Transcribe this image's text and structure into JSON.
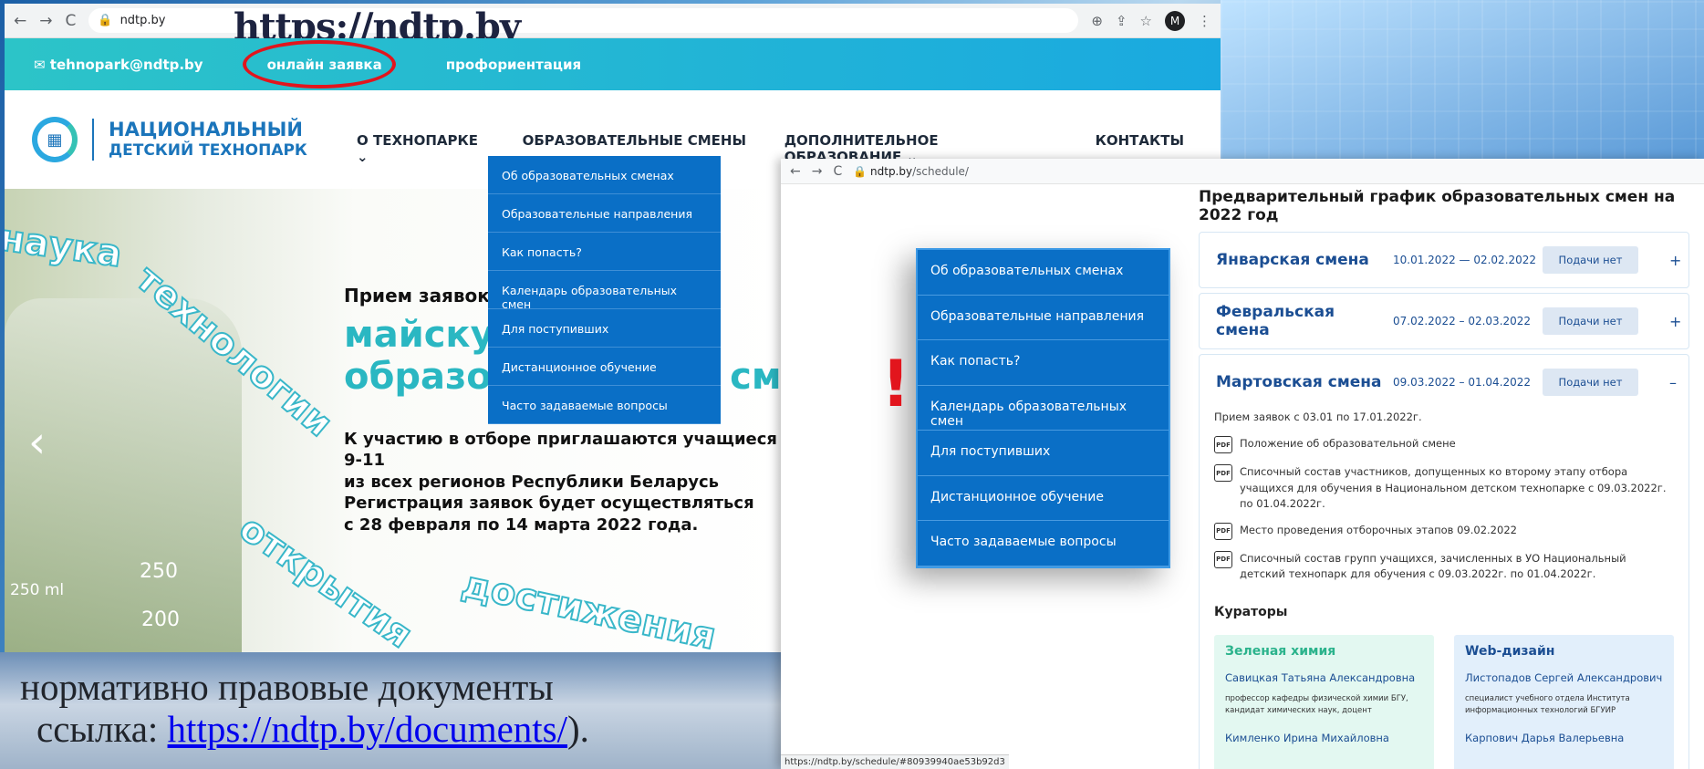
{
  "site": {
    "big_url": "https://ndtp.by",
    "address": "ndtp.by",
    "email": "tehnopark@ndtp.by",
    "topbar_links": [
      "онлайн заявка",
      "профориентация"
    ],
    "logo_line1": "НАЦИОНАЛЬНЫЙ",
    "logo_line2": "ДЕТСКИЙ ТЕХНОПАРК",
    "menu": [
      "О ТЕХНОПАРКЕ",
      "ОБРАЗОВАТЕЛЬНЫЕ СМЕНЫ",
      "ДОПОЛНИТЕЛЬНОЕ ОБРАЗОВАНИЕ",
      "КОНТАКТЫ"
    ],
    "dropdown": [
      "Об образовательных сменах",
      "Образовательные направления",
      "Как попасть?",
      "Календарь образовательных смен",
      "Для поступивших",
      "Дистанционное обучение",
      "Часто задаваемые вопросы"
    ],
    "hero": {
      "title_small": "Прием заявок",
      "title_big1": "майску",
      "title_big2": "образо",
      "title_big2_tail": "о см",
      "body1": "К участию в отборе приглашаются учащиеся 9-11",
      "body2": "из всех регионов Республики Беларусь",
      "body3": "Регистрация заявок будет осуществляться",
      "body4": "с 28 февраля по 14 марта 2022 года.",
      "arc_words": [
        "наука",
        "технологии",
        "открытия",
        "достижения"
      ],
      "beaker_labels": [
        "250",
        "250 ml",
        "200"
      ]
    },
    "avatar_letter": "M"
  },
  "caption": {
    "line1": "нормативно правовые документы",
    "line2_prefix": "ссылка:",
    "link": "https://ndtp.by/documents/",
    "line2_suffix": ")."
  },
  "schedule": {
    "address_host": "ndtp.by",
    "address_path": "/schedule/",
    "title": "Предварительный график образовательных смен на 2022 год",
    "shifts": [
      {
        "name": "Январская смена",
        "dates": "10.01.2022 — 02.02.2022",
        "button": "Подачи нет",
        "sign": "+"
      },
      {
        "name": "Февральская смена",
        "dates": "07.02.2022 – 02.03.2022",
        "button": "Подачи нет",
        "sign": "+"
      },
      {
        "name": "Мартовская смена",
        "dates": "09.03.2022 – 01.04.2022",
        "button": "Подачи нет",
        "sign": "–"
      }
    ],
    "intake": "Прием заявок с 03.01 по 17.01.2022г.",
    "docs": [
      "Положение об образовательной смене",
      "Списочный состав участников, допущенных ко второму этапу отбора учащихся для обучения в Национальном детском технопарке с 09.03.2022г. по 01.04.2022г.",
      "Место проведения отборочных этапов 09.02.2022",
      "Списочный состав групп учащихся, зачисленных в УО Национальный детский технопарк для обучения с 09.03.2022г. по 01.04.2022г."
    ],
    "pdf_label": "PDF",
    "curators_title": "Кураторы",
    "curators": [
      {
        "area": "Зеленая химия",
        "name1": "Савицкая Татьяна Александровна",
        "role1": "профессор кафедры физической химии БГУ, кандидат химических наук, доцент",
        "name2": "Кимленко Ирина Михайловна",
        "color": "#e3f8f1",
        "title_color": "#2bb38c"
      },
      {
        "area": "Web-дизайн",
        "name1": "Листопадов Сергей Александрович",
        "role1": "специалист учебного отдела Института информационных технологий БГУИР",
        "name2": "Карпович Дарья Валерьевна",
        "color": "#e2effb",
        "title_color": "#1b4e93"
      }
    ],
    "status_url": "https://ndtp.by/schedule/#80939940ae53b92d3"
  },
  "menu_zoom": [
    "Об образовательных сменах",
    "Образовательные направления",
    "Как попасть?",
    "Календарь образовательных смен",
    "Для поступивших",
    "Дистанционное обучение",
    "Часто задаваемые вопросы"
  ],
  "exclamation": "!"
}
